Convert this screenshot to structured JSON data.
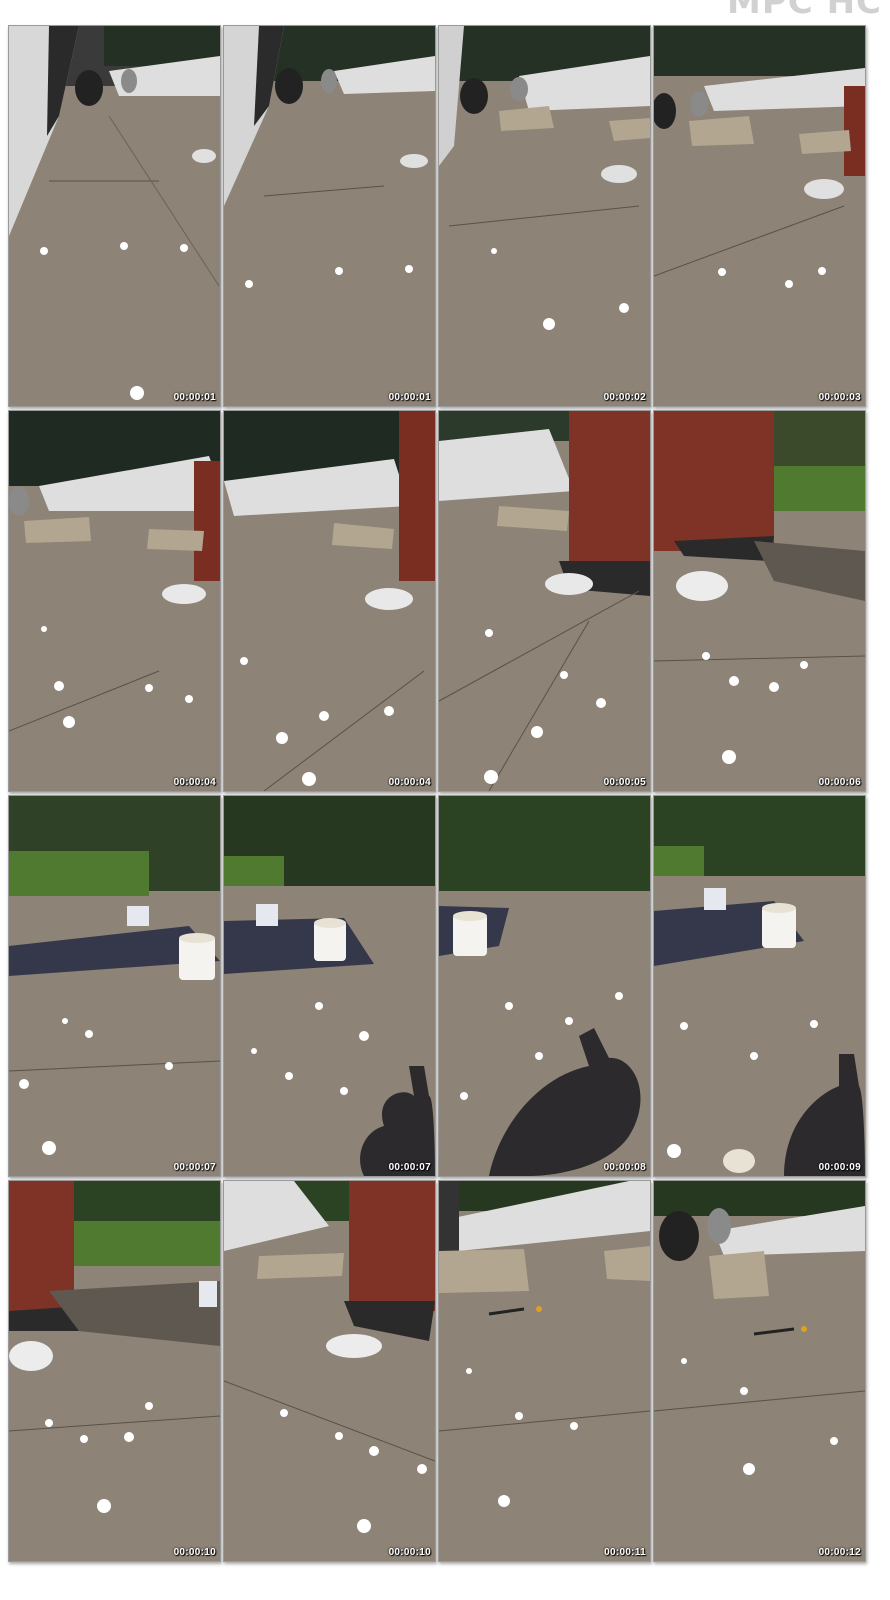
{
  "header": {
    "title_fragment": "MPC HC"
  },
  "frames": [
    {
      "timestamp": "00:00:01",
      "scene": "workers-house"
    },
    {
      "timestamp": "00:00:01",
      "scene": "workers-house"
    },
    {
      "timestamp": "00:00:02",
      "scene": "workers"
    },
    {
      "timestamp": "00:00:03",
      "scene": "workers-chimney"
    },
    {
      "timestamp": "00:00:04",
      "scene": "roof-bag"
    },
    {
      "timestamp": "00:00:04",
      "scene": "roof-bag"
    },
    {
      "timestamp": "00:00:05",
      "scene": "chimney-bag"
    },
    {
      "timestamp": "00:00:06",
      "scene": "chimney-yard"
    },
    {
      "timestamp": "00:00:07",
      "scene": "bucket-yard"
    },
    {
      "timestamp": "00:00:07",
      "scene": "bucket-shadow"
    },
    {
      "timestamp": "00:00:08",
      "scene": "bucket-shadow-large"
    },
    {
      "timestamp": "00:00:09",
      "scene": "bucket-shadow-right"
    },
    {
      "timestamp": "00:00:10",
      "scene": "chimney-yard-left"
    },
    {
      "timestamp": "00:00:10",
      "scene": "chimney-bag-center"
    },
    {
      "timestamp": "00:00:11",
      "scene": "roof-tools"
    },
    {
      "timestamp": "00:00:12",
      "scene": "workers-tools"
    }
  ],
  "colors": {
    "roof": "#8d8376",
    "roof_dark": "#7a7165",
    "sky_trees": "#1f2a22",
    "timestamp_text": "#ffffff"
  }
}
